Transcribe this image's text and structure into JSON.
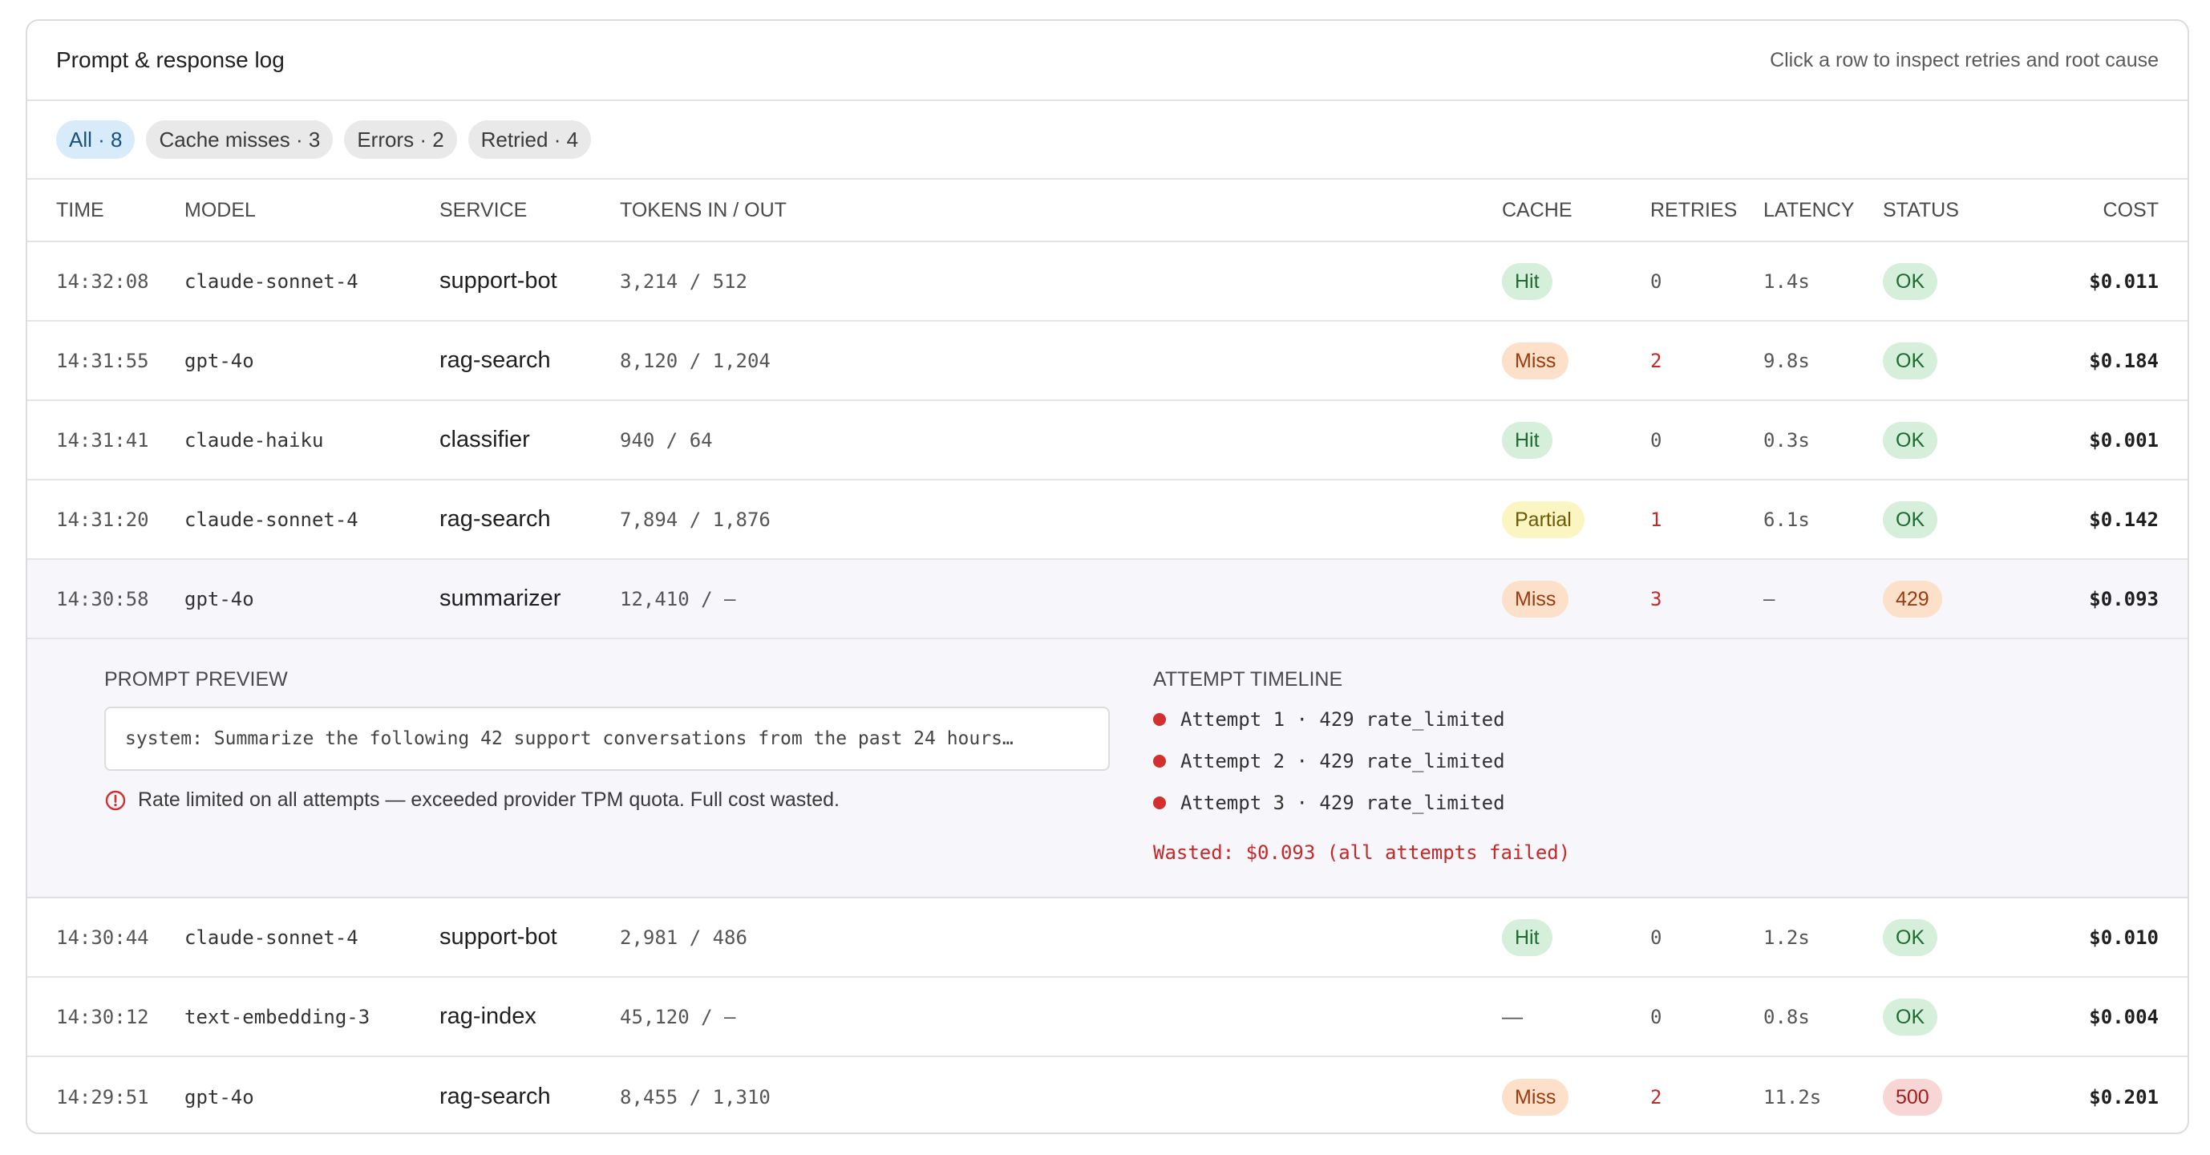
{
  "header": {
    "title": "Prompt & response log",
    "hint": "Click a row to inspect retries and root cause"
  },
  "filters": [
    {
      "label": "All · 8",
      "active": true
    },
    {
      "label": "Cache misses · 3",
      "active": false
    },
    {
      "label": "Errors · 2",
      "active": false
    },
    {
      "label": "Retried · 4",
      "active": false
    }
  ],
  "columns": {
    "time": "TIME",
    "model": "MODEL",
    "service": "SERVICE",
    "tokens": "TOKENS IN / OUT",
    "cache": "CACHE",
    "retries": "RETRIES",
    "latency": "LATENCY",
    "status": "STATUS",
    "cost": "COST"
  },
  "rows": [
    {
      "time": "14:32:08",
      "model": "claude-sonnet-4",
      "service": "support-bot",
      "tokens": "3,214 / 512",
      "cache": "Hit",
      "retries": "0",
      "latency": "1.4s",
      "status": "OK",
      "cost": "$0.011"
    },
    {
      "time": "14:31:55",
      "model": "gpt-4o",
      "service": "rag-search",
      "tokens": "8,120 / 1,204",
      "cache": "Miss",
      "retries": "2",
      "latency": "9.8s",
      "status": "OK",
      "cost": "$0.184"
    },
    {
      "time": "14:31:41",
      "model": "claude-haiku",
      "service": "classifier",
      "tokens": "940 / 64",
      "cache": "Hit",
      "retries": "0",
      "latency": "0.3s",
      "status": "OK",
      "cost": "$0.001"
    },
    {
      "time": "14:31:20",
      "model": "claude-sonnet-4",
      "service": "rag-search",
      "tokens": "7,894 / 1,876",
      "cache": "Partial",
      "retries": "1",
      "latency": "6.1s",
      "status": "OK",
      "cost": "$0.142"
    },
    {
      "time": "14:30:58",
      "model": "gpt-4o",
      "service": "summarizer",
      "tokens": "12,410 / —",
      "cache": "Miss",
      "retries": "3",
      "latency": "—",
      "status": "429",
      "cost": "$0.093"
    },
    {
      "time": "14:30:44",
      "model": "claude-sonnet-4",
      "service": "support-bot",
      "tokens": "2,981 / 486",
      "cache": "Hit",
      "retries": "0",
      "latency": "1.2s",
      "status": "OK",
      "cost": "$0.010"
    },
    {
      "time": "14:30:12",
      "model": "text-embedding-3",
      "service": "rag-index",
      "tokens": "45,120 / —",
      "cache": "—",
      "retries": "0",
      "latency": "0.8s",
      "status": "OK",
      "cost": "$0.004"
    },
    {
      "time": "14:29:51",
      "model": "gpt-4o",
      "service": "rag-search",
      "tokens": "8,455 / 1,310",
      "cache": "Miss",
      "retries": "2",
      "latency": "11.2s",
      "status": "500",
      "cost": "$0.201"
    }
  ],
  "detail": {
    "prompt_label": "PROMPT PREVIEW",
    "prompt_text": "system: Summarize the following 42 support conversations from the past 24 hours…",
    "warning": "Rate limited on all attempts — exceeded provider TPM quota. Full cost wasted.",
    "timeline_label": "ATTEMPT TIMELINE",
    "attempts": [
      "Attempt 1 · 429 rate_limited",
      "Attempt 2 · 429 rate_limited",
      "Attempt 3 · 429 rate_limited"
    ],
    "wasted": "Wasted: $0.093 (all attempts failed)"
  },
  "colors": {
    "error_red": "#d32f2f",
    "active_chip_bg": "#d8ebfa",
    "hit_bg": "#d5efda",
    "miss_bg": "#fde0c9",
    "partial_bg": "#fbf5c2",
    "error_bg": "#f9d6d6"
  },
  "icons": {
    "warning": "alert-circle-icon"
  }
}
